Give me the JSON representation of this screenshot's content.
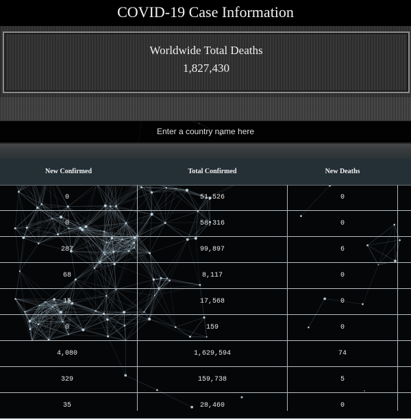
{
  "page": {
    "title": "COVID-19 Case Information"
  },
  "stat": {
    "label": "Worldwide Total Deaths",
    "value": "1,827,430"
  },
  "search": {
    "placeholder": "Enter a country name here",
    "value": ""
  },
  "table": {
    "headers": [
      "New Confirmed",
      "Total Confirmed",
      "New Deaths"
    ],
    "rows": [
      [
        "0",
        "51,526",
        "0"
      ],
      [
        "0",
        "58,316",
        "0"
      ],
      [
        "287",
        "99,897",
        "6"
      ],
      [
        "68",
        "8,117",
        "0"
      ],
      [
        "15",
        "17,568",
        "0"
      ],
      [
        "0",
        "159",
        "0"
      ],
      [
        "4,080",
        "1,629,594",
        "74"
      ],
      [
        "329",
        "159,738",
        "5"
      ],
      [
        "35",
        "28,460",
        "0"
      ]
    ]
  },
  "colors": {
    "background": "#050608",
    "header_bg": "#253036",
    "text": "#ffffff",
    "grid": "#b8c0c4"
  }
}
